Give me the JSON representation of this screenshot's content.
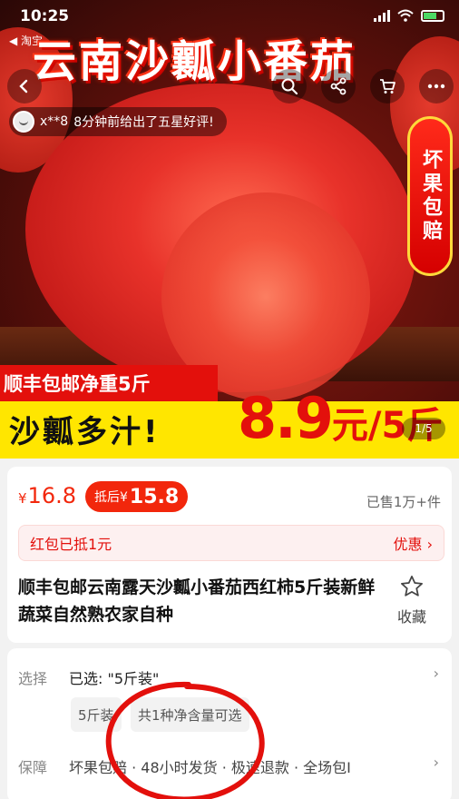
{
  "status_bar": {
    "time": "10:25",
    "back_app": "◀ 淘宝"
  },
  "hero": {
    "title": "云南沙瓤小番茄",
    "review": {
      "user": "x**8",
      "text": "8分钟前给出了五星好评!"
    },
    "badge": "坏果包赔",
    "promo_ribbon": "顺丰包邮净重5斤",
    "promo_slogan": "沙瓤多汁!",
    "promo_price": {
      "number": "8.9",
      "unit": "元/5斤"
    },
    "page_indicator": "1/5"
  },
  "colors": {
    "accent": "#f2270c",
    "promo_yellow": "#ffe600",
    "badge_border": "#ffd93a"
  },
  "icons": {
    "back": "chevron-left-icon",
    "search": "search-icon",
    "share": "share-icon",
    "cart": "cart-icon",
    "more": "more-icon",
    "favorite": "star-icon"
  },
  "price": {
    "currency": "¥",
    "current": "16.8",
    "coupon_tag": "抵后¥",
    "coupon_value": "15.8",
    "sold": "已售1万+件",
    "discount_text": "红包已抵1元",
    "discount_action": "优惠 ›"
  },
  "product": {
    "title": "顺丰包邮云南露天沙瓤小番茄西红柿5斤装新鲜蔬菜自然熟农家自种",
    "favorite_label": "收藏"
  },
  "options": {
    "select_label": "选择",
    "selected_text": "已选: \"5斤装\"",
    "chips": [
      "5斤装",
      "共1种净含量可选"
    ],
    "guarantee_label": "保障",
    "guarantee_text": "坏果包赔 · 48小时发货 · 极速退款 · 全场包I",
    "chevron": "›"
  }
}
